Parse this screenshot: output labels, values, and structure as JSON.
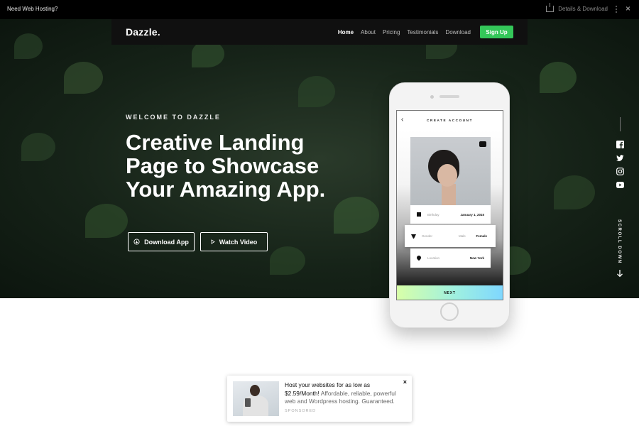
{
  "topbar": {
    "promo": "Need Web Hosting?",
    "details": "Details & Download"
  },
  "navbar": {
    "brand": "Dazzle.",
    "items": [
      {
        "label": "Home",
        "active": true
      },
      {
        "label": "About",
        "active": false
      },
      {
        "label": "Pricing",
        "active": false
      },
      {
        "label": "Testimonials",
        "active": false
      },
      {
        "label": "Download",
        "active": false
      }
    ],
    "cta": "Sign Up"
  },
  "hero": {
    "eyebrow": "WELCOME TO DAZZLE",
    "headline_lines": [
      "Creative Landing",
      "Page to Showcase",
      "Your Amazing App."
    ],
    "buttons": {
      "download": "Download App",
      "video": "Watch Video"
    }
  },
  "social": {
    "icons": [
      "facebook-icon",
      "twitter-icon",
      "instagram-icon",
      "youtube-icon"
    ],
    "scroll": "SCROLL DOWN"
  },
  "phone": {
    "title": "CREATE ACCOUNT",
    "fields": {
      "birthday": {
        "label": "Birthday",
        "value": "January 1, 2015"
      },
      "gender": {
        "label": "Gender",
        "option_a": "Male",
        "value": "Female"
      },
      "location": {
        "label": "Location",
        "value": "New York"
      }
    },
    "next": "NEXT"
  },
  "ad": {
    "headline": "Host your websites for as low as $2.59/Month!",
    "body": "Affordable, reliable, powerful web and Wordpress hosting. Guaranteed.",
    "sponsored": "SPONSORED"
  },
  "colors": {
    "accent": "#34c759",
    "bar": "#000000",
    "hero": "#162318"
  }
}
